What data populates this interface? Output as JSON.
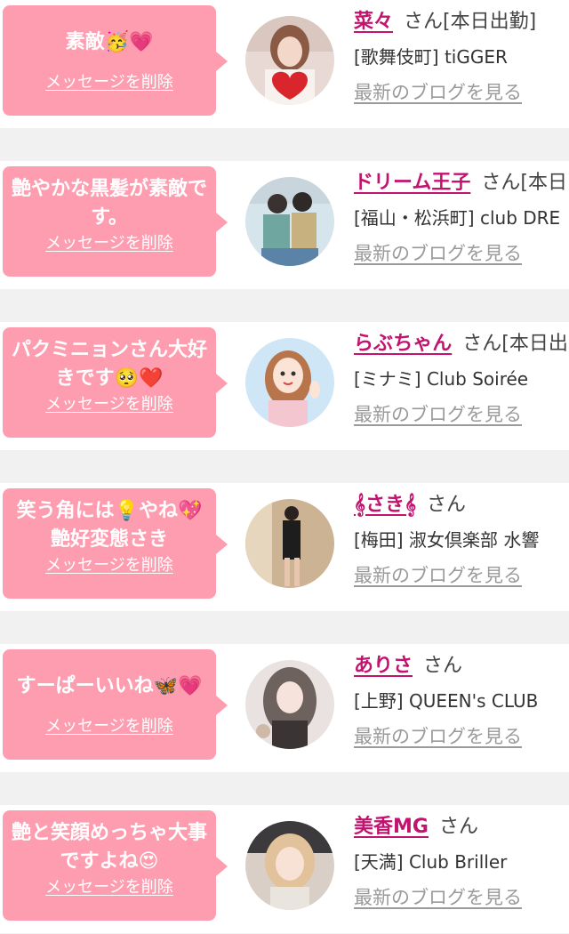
{
  "cards": [
    {
      "message": "素敵🥳💗",
      "delete_label": "メッセージを削除",
      "name": "菜々",
      "san": "さん",
      "status": "[本日出勤]",
      "shop": "[歌舞伎町] tiGGER",
      "blog_label": "最新のブログを見る"
    },
    {
      "message": "艶やかな黒髪が素敵です。",
      "delete_label": "メッセージを削除",
      "name": "ドリーム王子",
      "san": "さん",
      "status": "[本日",
      "shop": "[福山・松浜町] club DRE",
      "blog_label": "最新のブログを見る"
    },
    {
      "message": "パクミニョンさん大好きです🥺❤️",
      "delete_label": "メッセージを削除",
      "name": "らぶちゃん",
      "san": "さん",
      "status": "[本日出",
      "shop": "[ミナミ] Club Soirée",
      "blog_label": "最新のブログを見る"
    },
    {
      "message": "笑う角には💡やね💖艶好変態さき",
      "delete_label": "メッセージを削除",
      "name": "𝄞さき𝄞",
      "san": "さん",
      "status": "",
      "shop": "[梅田] 淑女倶楽部 水響",
      "blog_label": "最新のブログを見る"
    },
    {
      "message": "すーぱーいいね🦋💗",
      "delete_label": "メッセージを削除",
      "name": "ありさ",
      "san": "さん",
      "status": "",
      "shop": "[上野] QUEEN's CLUB",
      "blog_label": "最新のブログを見る"
    },
    {
      "message": "艶と笑顔めっちゃ大事ですよね😍",
      "delete_label": "メッセージを削除",
      "name": "美香MG",
      "san": "さん",
      "status": "",
      "shop": "[天満] Club Briller",
      "blog_label": "最新のブログを見る"
    }
  ],
  "colors": {
    "bubble": "#ff9db0",
    "name_link": "#c2136e",
    "blog_link": "#9a9a9a",
    "separator": "#f1f1f1"
  },
  "icons": [
    "avatar-photo-1",
    "avatar-photo-2",
    "avatar-photo-3",
    "avatar-photo-4",
    "avatar-photo-5",
    "avatar-photo-6"
  ]
}
